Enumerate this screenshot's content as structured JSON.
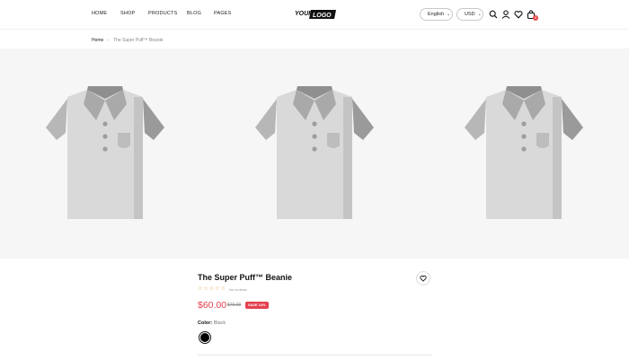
{
  "header": {
    "nav": [
      {
        "label": "HOME"
      },
      {
        "label": "SHOP"
      },
      {
        "label": "PRODUCTS"
      },
      {
        "label": "BLOG"
      },
      {
        "label": "PAGES"
      }
    ],
    "logo_text_1": "YOUR",
    "logo_text_2": "LOGO",
    "language": "English",
    "currency": "USD",
    "cart_count": "0",
    "icons": [
      "search-icon",
      "user-icon",
      "heart-icon",
      "cart-icon"
    ]
  },
  "breadcrumb": {
    "home": "Home",
    "separator": "›",
    "current": "The Super Puff™ Beanie"
  },
  "gallery": {
    "image_count": 3,
    "shirt_colors": {
      "body": "#d9d9d9",
      "shade": "#c2c2c2",
      "collar": "#a6a6a6",
      "sleeve": "#9a9a9a",
      "button": "#9d9d9d"
    }
  },
  "product": {
    "title": "The Super Puff™ Beanie",
    "rating": 0,
    "reviews": "No reviews",
    "price": "$60.00",
    "compare_price": "$70.00",
    "save_label": "SAVE 14%",
    "color_label": "Color:",
    "color_value": "Black",
    "swatch_color": "#000000",
    "accent_color": "#e4404f"
  }
}
